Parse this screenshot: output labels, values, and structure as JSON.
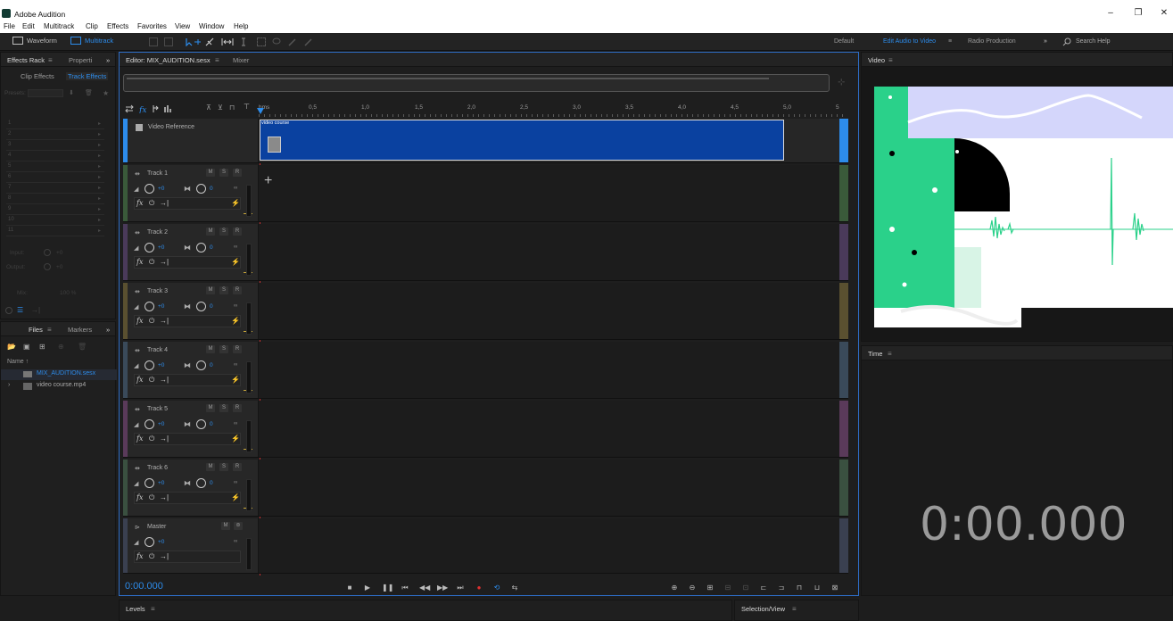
{
  "window": {
    "title": "Adobe Audition",
    "min": "–",
    "restore": "❐",
    "close": "✕"
  },
  "menu": [
    "File",
    "Edit",
    "Multitrack",
    "Clip",
    "Effects",
    "Favorites",
    "View",
    "Window",
    "Help"
  ],
  "toolbar": {
    "waveform_label": "Waveform",
    "multitrack_label": "Multitrack"
  },
  "workspaces": {
    "default": "Default",
    "edit_audio_to_video": "Edit Audio to Video",
    "radio_production": "Radio Production",
    "more": "»",
    "search_placeholder": "Search Help"
  },
  "effects_panel": {
    "tab_effects_rack": "Effects Rack",
    "tab_properties": "Properti",
    "more": "»",
    "clip_effects": "Clip Effects",
    "track_effects": "Track Effects",
    "presets_label": "Presets:",
    "slots": [
      "1",
      "2",
      "3",
      "4",
      "5",
      "6",
      "7",
      "8",
      "9",
      "10",
      "11"
    ],
    "input_label": "Input:",
    "output_label": "Output:",
    "input_value": "+0",
    "output_value": "+0",
    "mix_label": "Mix:",
    "mix_value": "100 %"
  },
  "files_panel": {
    "tab_files": "Files",
    "tab_markers": "Markers",
    "more": "»",
    "name_header": "Name ↑",
    "files": [
      {
        "name": "MIX_AUDITION.sesx",
        "active": true
      },
      {
        "name": "video course.mp4",
        "active": false
      }
    ]
  },
  "editor": {
    "tab_label": "Editor: MIX_AUDITION.sesx",
    "mixer_label": "Mixer",
    "current_time": "0:00.000"
  },
  "timeline": {
    "labels": [
      "hms",
      "0,5",
      "1,0",
      "1,5",
      "2,0",
      "2,5",
      "3,0",
      "3,5",
      "4,0",
      "4,5",
      "5,0",
      "5"
    ]
  },
  "video_track": {
    "name": "Video Reference",
    "clip_name": "video course"
  },
  "tracks": [
    {
      "name": "Track 1",
      "volume": "+0",
      "pan": "0",
      "color": "#3a5a3a"
    },
    {
      "name": "Track 2",
      "volume": "+0",
      "pan": "0",
      "color": "#4a3a5a"
    },
    {
      "name": "Track 3",
      "volume": "+0",
      "pan": "0",
      "color": "#5a5030"
    },
    {
      "name": "Track 4",
      "volume": "+0",
      "pan": "0",
      "color": "#3a4a5a"
    },
    {
      "name": "Track 5",
      "volume": "+0",
      "pan": "0",
      "color": "#5a3a5a"
    },
    {
      "name": "Track 6",
      "volume": "+0",
      "pan": "0",
      "color": "#3a5040"
    }
  ],
  "master": {
    "name": "Master",
    "volume": "+0"
  },
  "track_buttons": {
    "m": "M",
    "s": "S",
    "r": "R"
  },
  "video_panel": {
    "title": "Video"
  },
  "time_panel": {
    "title": "Time",
    "value": "0:00.000"
  },
  "bottom": {
    "levels": "Levels",
    "selection_view": "Selection/View"
  },
  "colors": {
    "accent": "#2d8ceb",
    "clip_blue": "#0a41a0",
    "video_green": "#2dd18a",
    "video_lavender": "#d4d6fb"
  }
}
